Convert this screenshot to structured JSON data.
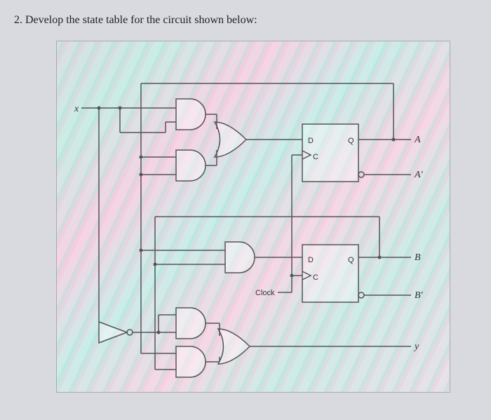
{
  "question": {
    "number": "2.",
    "text": "Develop the state table for the circuit shown below:"
  },
  "labels": {
    "input_x": "x",
    "clock": "Clock",
    "ff1_D": "D",
    "ff1_C": "C",
    "ff1_Q": "Q",
    "ff2_D": "D",
    "ff2_C": "C",
    "ff2_Q": "Q",
    "out_A": "A",
    "out_Aprime": "A'",
    "out_B": "B",
    "out_Bprime": "B'",
    "out_y": "y"
  }
}
